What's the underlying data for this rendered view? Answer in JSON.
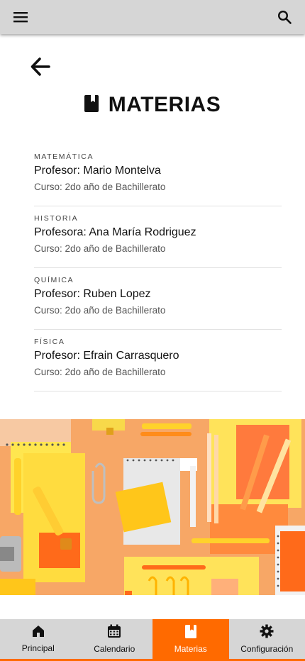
{
  "page": {
    "title": "MATERIAS"
  },
  "topbar": {
    "menu_icon": "menu-icon",
    "search_icon": "search-icon"
  },
  "subjects": [
    {
      "subject": "MATEMÁTICA",
      "teacher": "Profesor: Mario Montelva",
      "course": "Curso: 2do año de Bachillerato"
    },
    {
      "subject": "HISTORIA",
      "teacher": "Profesora: Ana María Rodriguez",
      "course": "Curso: 2do año de Bachillerato"
    },
    {
      "subject": "QUÍMICA",
      "teacher": "Profesor: Ruben Lopez",
      "course": "Curso: 2do año de Bachillerato"
    },
    {
      "subject": "FÍSICA",
      "teacher": "Profesor: Efrain Carrasquero",
      "course": "Curso: 2do año de Bachillerato"
    }
  ],
  "bottom_nav": [
    {
      "label": "Principal",
      "icon": "home-icon",
      "active": false
    },
    {
      "label": "Calendario",
      "icon": "calendar-icon",
      "active": false
    },
    {
      "label": "Materias",
      "icon": "book-icon",
      "active": true
    },
    {
      "label": "Configuración",
      "icon": "gear-icon",
      "active": false
    }
  ],
  "colors": {
    "accent": "#ff6a00",
    "bar_background": "#d6d6d6"
  }
}
